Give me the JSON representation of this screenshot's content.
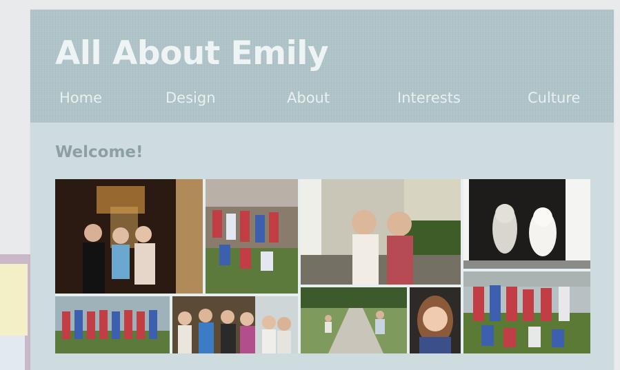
{
  "header": {
    "site_title": "All About Emily",
    "nav": [
      "Home",
      "Design",
      "About",
      "Interests",
      "Culture"
    ]
  },
  "main": {
    "heading": "Welcome!",
    "photos": [
      "friends-at-night-photo",
      "team-group-photo",
      "two-girls-outdoors-photo",
      "two-dogs-in-doorway-photo",
      "team-lineup-photo",
      "friends-group-indoors-photo",
      "two-girls-close-up-photo",
      "bike-path-photo",
      "girl-portrait-photo",
      "team-on-field-photo"
    ]
  },
  "colors": {
    "header_bg": "#afc4c8",
    "page_bg": "#cfdcdf",
    "title_text": "#eef3f3",
    "heading_text": "#8d9fa3"
  }
}
